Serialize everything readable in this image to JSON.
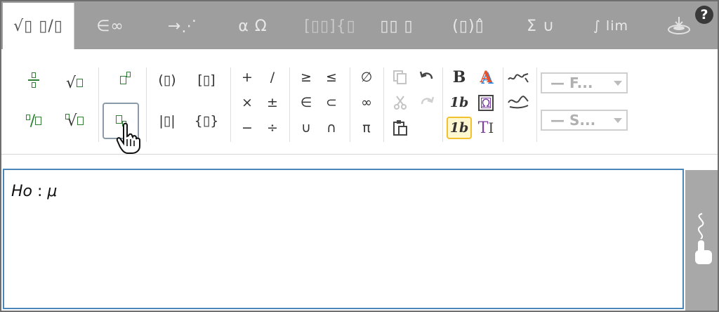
{
  "tabs": [
    {
      "label": "√▯ ▯/▯",
      "active": true
    },
    {
      "label": "∈∞",
      "active": false
    },
    {
      "label": "→⋰",
      "active": false
    },
    {
      "label": "α Ω",
      "active": false
    },
    {
      "label": "[▯▯]{▯",
      "active": false
    },
    {
      "label": "▯▯ ▯",
      "active": false
    },
    {
      "label": "(▯)▯̂",
      "active": false
    },
    {
      "label": "Σ ∪",
      "active": false
    },
    {
      "label": "∫ lim",
      "active": false
    }
  ],
  "help_label": "?",
  "toolbar": {
    "operators": [
      "+",
      "/",
      "×",
      "±",
      "−",
      "÷"
    ],
    "relations": [
      "≥",
      "≤",
      "∈",
      "⊂",
      "∪",
      "∩"
    ],
    "symbols": [
      "∅",
      "∞",
      "π"
    ],
    "brackets": [
      "(▯)",
      "[▯]",
      "|▯|",
      "{▯}"
    ],
    "bold_label": "B",
    "italic_b_label": "1b",
    "italic_b2_label": "1b",
    "text_mode_label": "T",
    "font_select": "— F...",
    "size_select": "— S..."
  },
  "editor": {
    "formula_var": "Ho",
    "formula_sep": " : ",
    "formula_mu": "μ"
  },
  "colors": {
    "accent": "#4a86b8",
    "green": "#2e7d32",
    "tabbar": "#9e9e9e"
  }
}
